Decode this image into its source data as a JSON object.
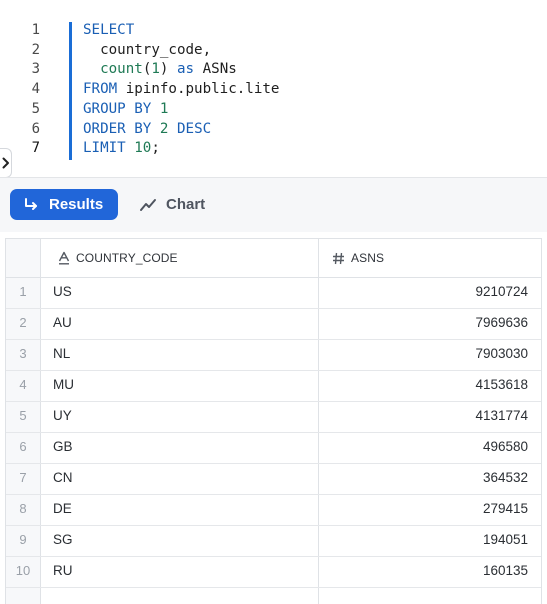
{
  "editor": {
    "line_numbers": [
      "1",
      "2",
      "3",
      "4",
      "5",
      "6",
      "7"
    ],
    "lines": [
      [
        {
          "t": "SELECT",
          "c": "kw"
        }
      ],
      [
        {
          "t": "  country_code,",
          "c": ""
        }
      ],
      [
        {
          "t": "  ",
          "c": ""
        },
        {
          "t": "count",
          "c": "fn"
        },
        {
          "t": "(",
          "c": ""
        },
        {
          "t": "1",
          "c": "num"
        },
        {
          "t": ") ",
          "c": ""
        },
        {
          "t": "as",
          "c": "kw"
        },
        {
          "t": " ASNs",
          "c": ""
        }
      ],
      [
        {
          "t": "FROM",
          "c": "kw"
        },
        {
          "t": " ipinfo.public.lite",
          "c": ""
        }
      ],
      [
        {
          "t": "GROUP BY",
          "c": "kw"
        },
        {
          "t": " ",
          "c": ""
        },
        {
          "t": "1",
          "c": "num"
        }
      ],
      [
        {
          "t": "ORDER BY",
          "c": "kw"
        },
        {
          "t": " ",
          "c": ""
        },
        {
          "t": "2",
          "c": "num"
        },
        {
          "t": " ",
          "c": ""
        },
        {
          "t": "DESC",
          "c": "kw"
        }
      ],
      [
        {
          "t": "LIMIT",
          "c": "kw"
        },
        {
          "t": " ",
          "c": ""
        },
        {
          "t": "10",
          "c": "num"
        },
        {
          "t": ";",
          "c": ""
        }
      ]
    ]
  },
  "toolbar": {
    "results_label": "Results",
    "chart_label": "Chart"
  },
  "table": {
    "columns": [
      {
        "label": "COUNTRY_CODE",
        "icon": "text-type-icon"
      },
      {
        "label": "ASNS",
        "icon": "hash-icon"
      }
    ],
    "rows": [
      {
        "n": "1",
        "country": "US",
        "asns": "9210724"
      },
      {
        "n": "2",
        "country": "AU",
        "asns": "7969636"
      },
      {
        "n": "3",
        "country": "NL",
        "asns": "7903030"
      },
      {
        "n": "4",
        "country": "MU",
        "asns": "4153618"
      },
      {
        "n": "5",
        "country": "UY",
        "asns": "4131774"
      },
      {
        "n": "6",
        "country": "GB",
        "asns": "496580"
      },
      {
        "n": "7",
        "country": "CN",
        "asns": "364532"
      },
      {
        "n": "8",
        "country": "DE",
        "asns": "279415"
      },
      {
        "n": "9",
        "country": "SG",
        "asns": "194051"
      },
      {
        "n": "10",
        "country": "RU",
        "asns": "160135"
      }
    ]
  },
  "colors": {
    "accent": "#2166d9",
    "keyword": "#1a5fb4",
    "function": "#1f7a55"
  }
}
